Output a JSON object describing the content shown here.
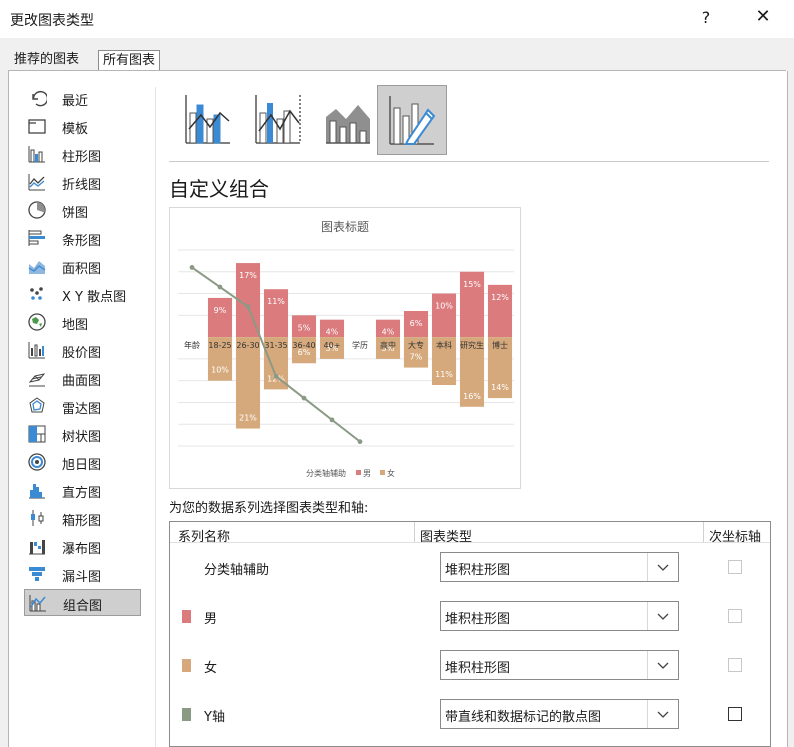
{
  "dialog": {
    "title": "更改图表类型",
    "help": "?",
    "close": "✕"
  },
  "tabs": [
    {
      "label": "推荐的图表"
    },
    {
      "label": "所有图表"
    }
  ],
  "sidebar": {
    "items": [
      {
        "label": "最近",
        "icon": "undo-icon"
      },
      {
        "label": "模板",
        "icon": "folder-icon"
      },
      {
        "label": "柱形图",
        "icon": "column-chart-icon"
      },
      {
        "label": "折线图",
        "icon": "line-chart-icon"
      },
      {
        "label": "饼图",
        "icon": "pie-chart-icon"
      },
      {
        "label": "条形图",
        "icon": "bar-chart-icon"
      },
      {
        "label": "面积图",
        "icon": "area-chart-icon"
      },
      {
        "label": "X Y 散点图",
        "icon": "scatter-chart-icon"
      },
      {
        "label": "地图",
        "icon": "map-chart-icon"
      },
      {
        "label": "股价图",
        "icon": "stock-chart-icon"
      },
      {
        "label": "曲面图",
        "icon": "surface-chart-icon"
      },
      {
        "label": "雷达图",
        "icon": "radar-chart-icon"
      },
      {
        "label": "树状图",
        "icon": "treemap-chart-icon"
      },
      {
        "label": "旭日图",
        "icon": "sunburst-chart-icon"
      },
      {
        "label": "直方图",
        "icon": "histogram-chart-icon"
      },
      {
        "label": "箱形图",
        "icon": "box-whisker-chart-icon"
      },
      {
        "label": "瀑布图",
        "icon": "waterfall-chart-icon"
      },
      {
        "label": "漏斗图",
        "icon": "funnel-chart-icon"
      },
      {
        "label": "组合图",
        "icon": "combo-chart-icon"
      }
    ],
    "selected": 18
  },
  "combo_types": {
    "selected": 3,
    "icons": [
      "clustered-column-line-icon",
      "clustered-column-line-secondary-icon",
      "stacked-area-column-icon",
      "custom-combination-icon"
    ]
  },
  "section_title": "自定义组合",
  "prompt": "为您的数据系列选择图表类型和轴:",
  "colors": {
    "male": "#db7b7e",
    "female": "#d6a97c",
    "yaxis": "#8a9a84",
    "accent": "#3b8ad4"
  },
  "grid": {
    "headers": {
      "name": "系列名称",
      "type": "图表类型",
      "secondary": "次坐标轴"
    },
    "rows": [
      {
        "name": "分类轴辅助",
        "type": "堆积柱形图",
        "checked": false,
        "enabled": false,
        "swatch": ""
      },
      {
        "name": "男",
        "type": "堆积柱形图",
        "checked": false,
        "enabled": false,
        "swatch": "#db7b7e"
      },
      {
        "name": "女",
        "type": "堆积柱形图",
        "checked": false,
        "enabled": false,
        "swatch": "#d6a97c"
      },
      {
        "name": "Y轴",
        "type": "带直线和数据标记的散点图",
        "checked": false,
        "enabled": true,
        "swatch": "#8a9a84"
      }
    ]
  },
  "chart_data": {
    "type": "bar",
    "title": "图表标题",
    "categories": [
      "年龄",
      "18-25",
      "26-30",
      "31-35",
      "36-40",
      "40+",
      "学历",
      "高中",
      "大专",
      "本科",
      "研究生",
      "博士"
    ],
    "series": [
      {
        "name": "男",
        "values": [
          null,
          9,
          17,
          11,
          5,
          4,
          null,
          4,
          6,
          10,
          15,
          12
        ],
        "labels": [
          "",
          "9%",
          "17%",
          "11%",
          "5%",
          "4%",
          "",
          "4%",
          "6%",
          "10%",
          "15%",
          "12%"
        ]
      },
      {
        "name": "女",
        "values": [
          null,
          -10,
          -21,
          -12,
          -6,
          -5,
          null,
          -5,
          -7,
          -11,
          -16,
          -14
        ],
        "labels": [
          "",
          "10%",
          "21%",
          "12%",
          "6%",
          "5%",
          "",
          "5%",
          "7%",
          "11%",
          "16%",
          "14%"
        ]
      }
    ],
    "line": {
      "x": [
        0,
        1,
        2,
        3,
        4,
        5,
        6
      ],
      "y": [
        16,
        11.5,
        7,
        -9,
        -14,
        -19,
        -24
      ]
    },
    "legend": [
      {
        "name": "分类轴辅助"
      },
      {
        "name": "男"
      },
      {
        "name": "女"
      }
    ],
    "ylim": [
      -25,
      20
    ],
    "grid": true,
    "legend_position": "bottom"
  }
}
